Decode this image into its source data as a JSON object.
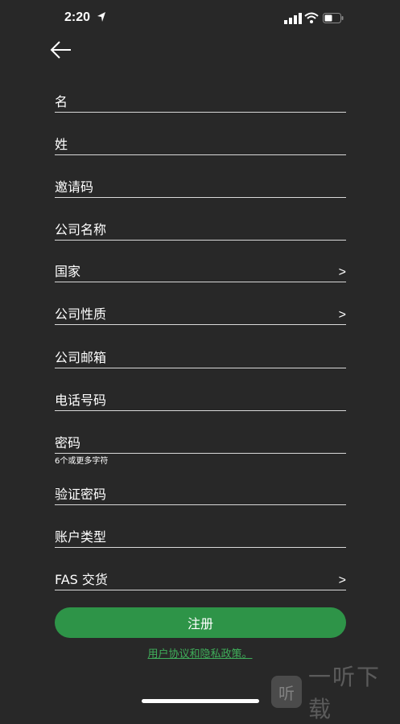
{
  "status": {
    "time": "2:20"
  },
  "form": {
    "fields": [
      {
        "label": "名"
      },
      {
        "label": "姓"
      },
      {
        "label": "邀请码"
      },
      {
        "label": "公司名称"
      },
      {
        "label": "国家",
        "chevron": ">"
      },
      {
        "label": "公司性质",
        "chevron": ">"
      },
      {
        "label": "公司邮箱"
      },
      {
        "label": "电话号码"
      },
      {
        "label": "密码"
      },
      {
        "label": "验证密码"
      },
      {
        "label": "账户类型"
      },
      {
        "label": "FAS 交货",
        "chevron": ">"
      }
    ],
    "password_hint": "6个或更多字符",
    "register_label": "注册",
    "policy_link": "用户协议和隐私政策。"
  },
  "watermark": {
    "badge": "听",
    "text": "一听下载"
  },
  "colors": {
    "background": "#282828",
    "accent": "#2e9448",
    "link": "#3fae5a"
  }
}
